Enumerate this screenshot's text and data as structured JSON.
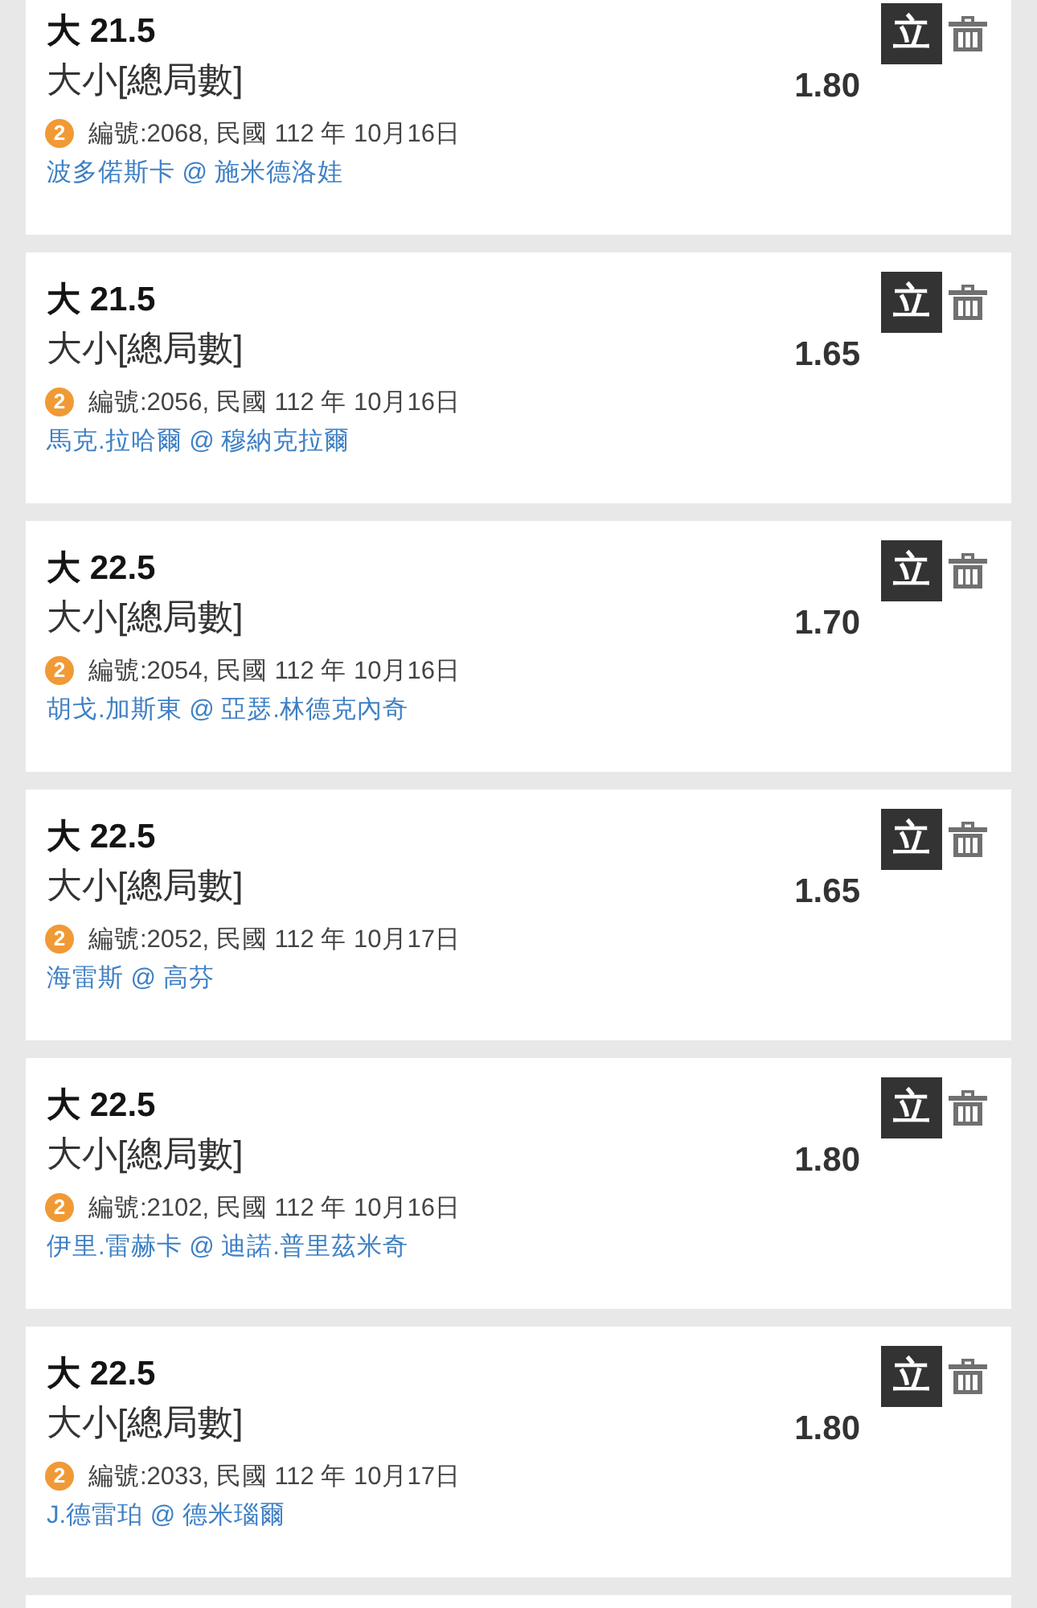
{
  "bets": [
    {
      "selection": "大 21.5",
      "market": "大小[總局數]",
      "odds": "1.80",
      "badge": "2",
      "details": "編號:2068, 民國 112 年 10月16日",
      "match": "波多偌斯卡 @ 施米德洛娃",
      "action": "立"
    },
    {
      "selection": "大 21.5",
      "market": "大小[總局數]",
      "odds": "1.65",
      "badge": "2",
      "details": "編號:2056, 民國 112 年 10月16日",
      "match": "馬克.拉哈爾 @ 穆納克拉爾",
      "action": "立"
    },
    {
      "selection": "大 22.5",
      "market": "大小[總局數]",
      "odds": "1.70",
      "badge": "2",
      "details": "編號:2054, 民國 112 年 10月16日",
      "match": "胡戈.加斯東 @ 亞瑟.林德克內奇",
      "action": "立"
    },
    {
      "selection": "大 22.5",
      "market": "大小[總局數]",
      "odds": "1.65",
      "badge": "2",
      "details": "編號:2052, 民國 112 年 10月17日",
      "match": "海雷斯 @ 高芬",
      "action": "立"
    },
    {
      "selection": "大 22.5",
      "market": "大小[總局數]",
      "odds": "1.80",
      "badge": "2",
      "details": "編號:2102, 民國 112 年 10月16日",
      "match": "伊里.雷赫卡 @ 迪諾.普里茲米奇",
      "action": "立"
    },
    {
      "selection": "大 22.5",
      "market": "大小[總局數]",
      "odds": "1.80",
      "badge": "2",
      "details": "編號:2033, 民國 112 年 10月17日",
      "match": "J.德雷珀 @ 德米瑙爾",
      "action": "立"
    }
  ]
}
